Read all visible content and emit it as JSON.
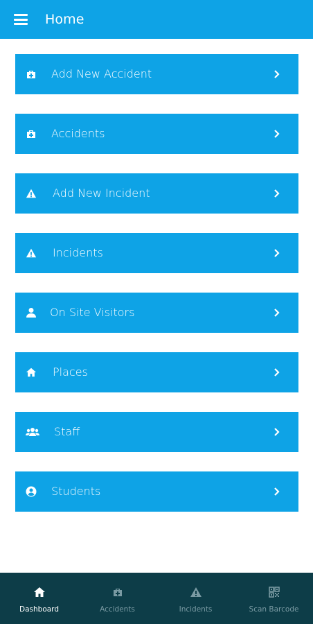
{
  "header": {
    "title": "Home"
  },
  "menu": [
    {
      "label": "Add New Accident",
      "icon": "medkit-icon"
    },
    {
      "label": "Accidents",
      "icon": "medkit-icon"
    },
    {
      "label": "Add New Incident",
      "icon": "warning-icon"
    },
    {
      "label": "Incidents",
      "icon": "warning-icon"
    },
    {
      "label": "On Site Visitors",
      "icon": "person-icon"
    },
    {
      "label": "Places",
      "icon": "home-icon"
    },
    {
      "label": "Staff",
      "icon": "people-icon"
    },
    {
      "label": "Students",
      "icon": "user-circle-icon"
    }
  ],
  "bottom_nav": [
    {
      "label": "Dashboard",
      "icon": "home-icon",
      "active": true
    },
    {
      "label": "Accidents",
      "icon": "medkit-icon",
      "active": false
    },
    {
      "label": "Incidents",
      "icon": "warning-icon",
      "active": false
    },
    {
      "label": "Scan Barcode",
      "icon": "qr-code-icon",
      "active": false
    }
  ],
  "colors": {
    "primary": "#0ea3e6",
    "nav_bg": "#0d3d48",
    "nav_inactive": "#7a9aa3"
  }
}
